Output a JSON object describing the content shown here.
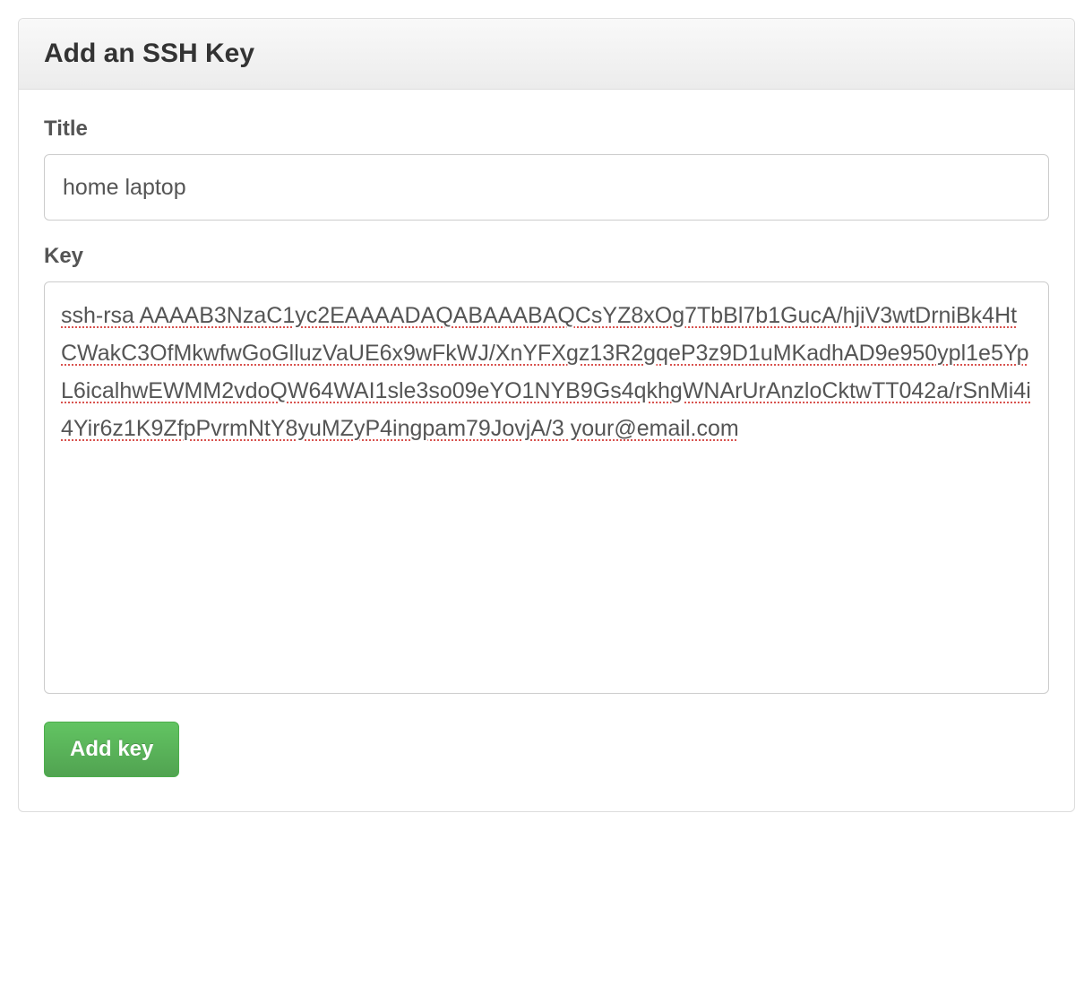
{
  "panel": {
    "title": "Add an SSH Key"
  },
  "form": {
    "title_label": "Title",
    "title_value": "home laptop",
    "key_label": "Key",
    "key_value": "ssh-rsa AAAAB3NzaC1yc2EAAAADAQABAAABAQCsYZ8xOg7TbBl7b1GucA/hjiV3wtDrniBk4HtCWakC3OfMkwfwGoGlluzVaUE6x9wFkWJ/XnYFXgz13R2gqeP3z9D1uMKadhAD9e950ypl1e5YpL6icalhwEWMM2vdoQW64WAI1sle3so09eYO1NYB9Gs4qkhgWNArUrAnzloCktwTT042a/rSnMi4i4Yir6z1K9ZfpPvrmNtY8yuMZyP4ingpam79JovjA/3 your@email.com",
    "submit_label": "Add key"
  }
}
